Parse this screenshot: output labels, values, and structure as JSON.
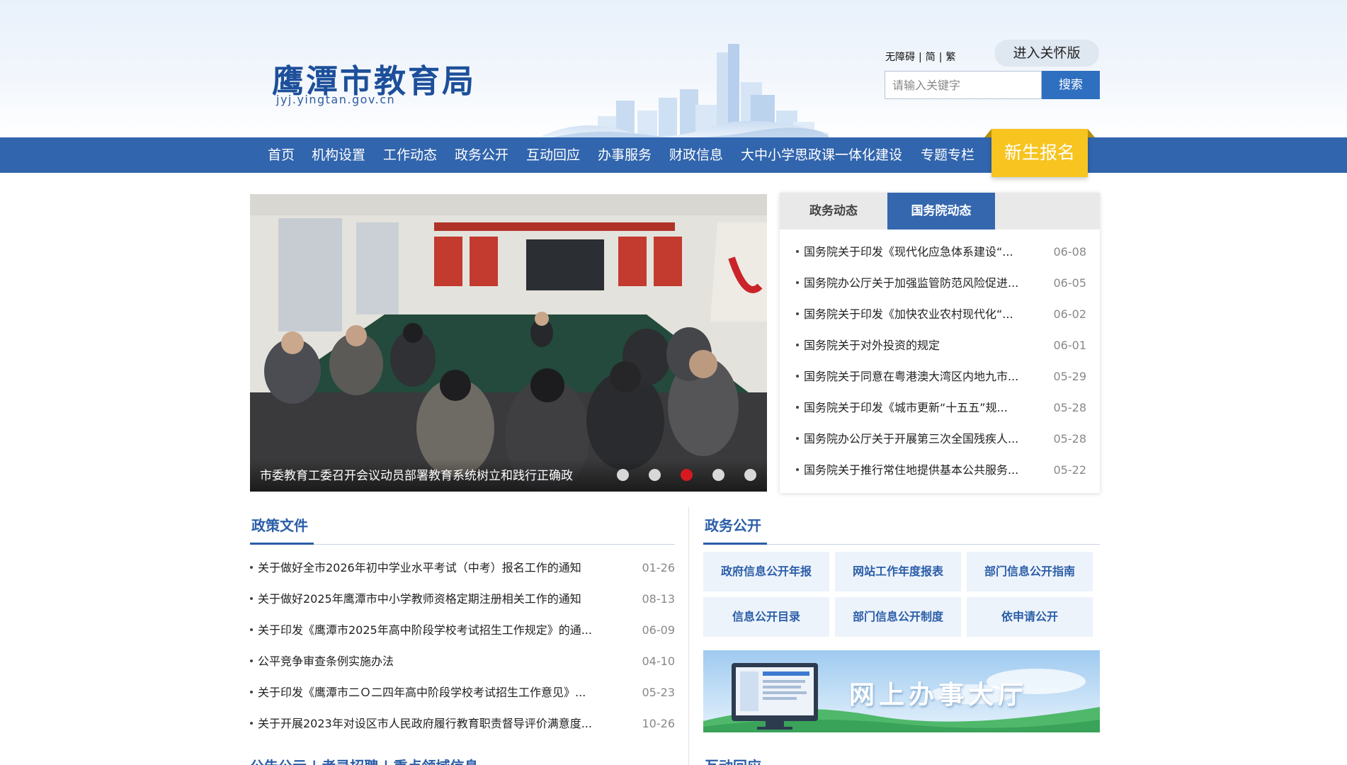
{
  "site": {
    "name": "鹰潭市教育局",
    "domain": "jyj.yingtan.gov.cn"
  },
  "toplinks": {
    "accessibility": "无障碍",
    "simplified": "简",
    "traditional": "繁",
    "care_mode": "进入关怀版"
  },
  "search": {
    "placeholder": "请输入关键字",
    "button": "搜索"
  },
  "nav": {
    "items": [
      "首页",
      "机构设置",
      "工作动态",
      "政务公开",
      "互动回应",
      "办事服务",
      "财政信息",
      "大中小学思政课一体化建设",
      "专题专栏"
    ],
    "highlight": "新生报名"
  },
  "slider": {
    "caption": "市委教育工委召开会议动员部署教育系统树立和践行正确政",
    "dot_count": 5,
    "active_dot": 3
  },
  "news_tabs": {
    "tabs": [
      "政务动态",
      "国务院动态"
    ],
    "active": 1,
    "items": [
      {
        "title": "国务院关于印发《现代化应急体系建设“...",
        "date": "06-08"
      },
      {
        "title": "国务院办公厅关于加强监管防范风险促进...",
        "date": "06-05"
      },
      {
        "title": "国务院关于印发《加快农业农村现代化“...",
        "date": "06-02"
      },
      {
        "title": "国务院关于对外投资的规定",
        "date": "06-01"
      },
      {
        "title": "国务院关于同意在粤港澳大湾区内地九市...",
        "date": "05-29"
      },
      {
        "title": "国务院关于印发《城市更新“十五五”规...",
        "date": "05-28"
      },
      {
        "title": "国务院办公厅关于开展第三次全国残疾人...",
        "date": "05-28"
      },
      {
        "title": "国务院关于推行常住地提供基本公共服务...",
        "date": "05-22"
      }
    ]
  },
  "policy": {
    "title": "政策文件",
    "items": [
      {
        "title": "关于做好全市2026年初中学业水平考试（中考）报名工作的通知",
        "date": "01-26"
      },
      {
        "title": "关于做好2025年鹰潭市中小学教师资格定期注册相关工作的通知",
        "date": "08-13"
      },
      {
        "title": "关于印发《鹰潭市2025年高中阶段学校考试招生工作规定》的通...",
        "date": "06-09"
      },
      {
        "title": "公平竞争审查条例实施办法",
        "date": "04-10"
      },
      {
        "title": "关于印发《鹰潭市二Ｏ二四年高中阶段学校考试招生工作意见》...",
        "date": "05-23"
      },
      {
        "title": "关于开展2023年对设区市人民政府履行教育职责督导评价满意度...",
        "date": "10-26"
      }
    ]
  },
  "gov_open": {
    "title": "政务公开",
    "buttons": [
      "政府信息公开年报",
      "网站工作年度报表",
      "部门信息公开指南",
      "信息公开目录",
      "部门信息公开制度",
      "依申请公开"
    ]
  },
  "banner": {
    "text": "网上办事大厅"
  },
  "bottom": {
    "left_title": "公告公示 | 考录招聘 | 重点领域信息",
    "right_title": "互动回应"
  },
  "colors": {
    "primary": "#3165ad",
    "accent_yellow": "#f7c420",
    "active_dot": "#d6191f",
    "link_blue": "#2b5ea8"
  }
}
